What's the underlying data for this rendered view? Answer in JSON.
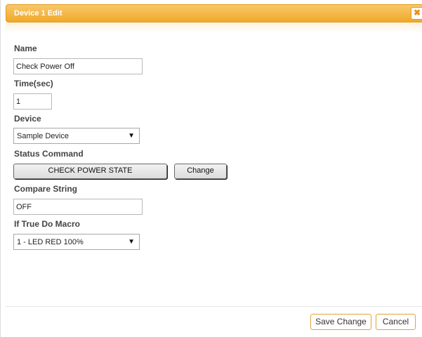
{
  "dialog": {
    "title": "Device 1 Edit",
    "close_symbol": "✖"
  },
  "form": {
    "name": {
      "label": "Name",
      "value": "Check Power Off"
    },
    "time": {
      "label": "Time(sec)",
      "value": "1"
    },
    "device": {
      "label": "Device",
      "selected": "Sample Device"
    },
    "status_command": {
      "label": "Status Command",
      "value_button": "CHECK POWER STATE",
      "change_button": "Change"
    },
    "compare_string": {
      "label": "Compare String",
      "value": "OFF"
    },
    "if_true_macro": {
      "label": "If True Do Macro",
      "selected": "1 - LED RED 100%"
    }
  },
  "footer": {
    "save_label": "Save Change",
    "cancel_label": "Cancel"
  },
  "icons": {
    "close": "close-icon",
    "dropdown": "chevron-down-icon"
  },
  "colors": {
    "title_bar": "#f0a92a",
    "button_border": "#e0a43a"
  }
}
